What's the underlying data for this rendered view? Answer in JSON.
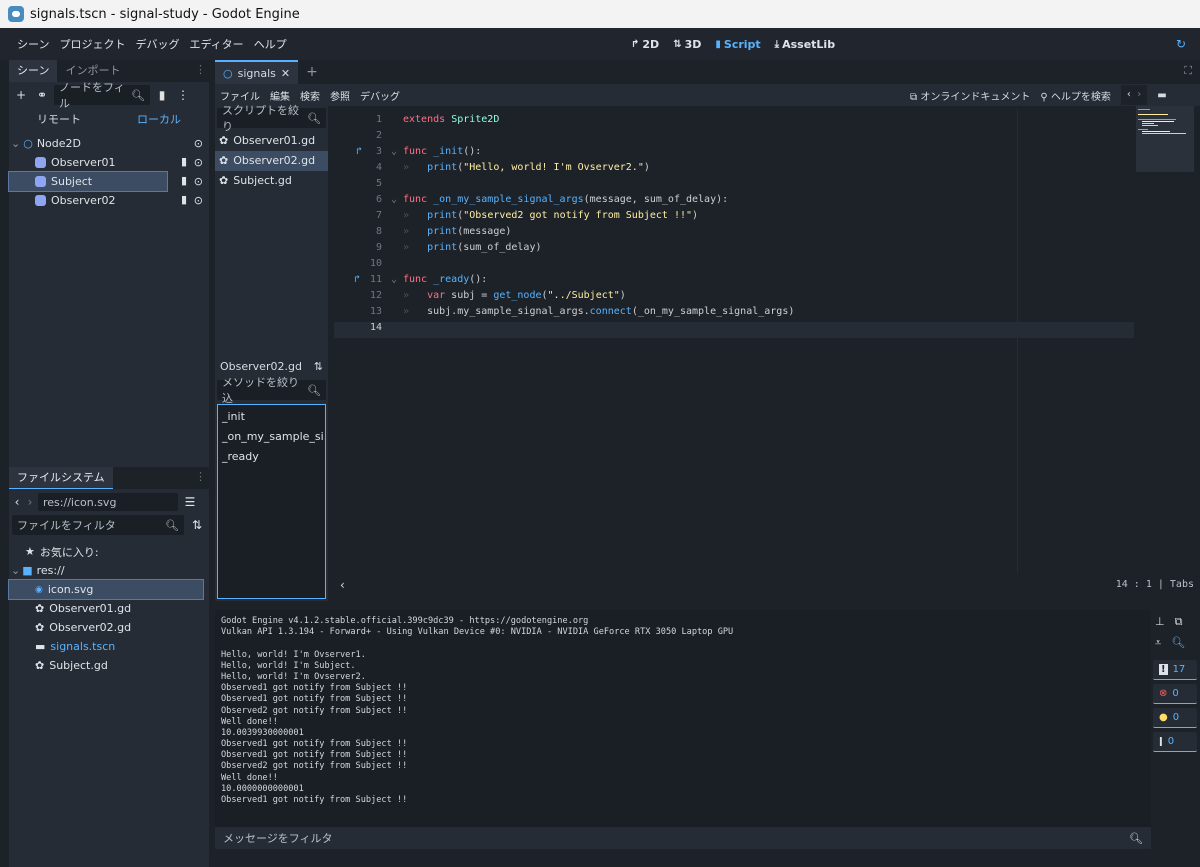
{
  "window_title": "signals.tscn - signal-study - Godot Engine",
  "menubar": {
    "items": [
      "シーン",
      "プロジェクト",
      "デバッグ",
      "エディター",
      "ヘルプ"
    ],
    "workspaces": [
      "2D",
      "3D",
      "Script",
      "AssetLib"
    ]
  },
  "scene_dock": {
    "tabs": [
      "シーン",
      "インポート"
    ],
    "filter_placeholder": "ノードをフィル",
    "remote": "リモート",
    "local": "ローカル",
    "nodes": [
      {
        "name": "Node2D",
        "type": "root"
      },
      {
        "name": "Observer01",
        "type": "child"
      },
      {
        "name": "Subject",
        "type": "child",
        "selected": true
      },
      {
        "name": "Observer02",
        "type": "child"
      }
    ]
  },
  "filesystem_dock": {
    "tab": "ファイルシステム",
    "path": "res://icon.svg",
    "filter_placeholder": "ファイルをフィルタ",
    "favorites": "お気に入り:",
    "root": "res://",
    "files": [
      "icon.svg",
      "Observer01.gd",
      "Observer02.gd",
      "signals.tscn",
      "Subject.gd"
    ]
  },
  "script_editor": {
    "tab": "signals",
    "menu": [
      "ファイル",
      "編集",
      "検索",
      "参照",
      "デバッグ"
    ],
    "online_docs": "オンラインドキュメント",
    "help_search": "ヘルプを検索",
    "script_filter_placeholder": "スクリプトを絞り",
    "scripts": [
      "Observer01.gd",
      "Observer02.gd",
      "Subject.gd"
    ],
    "current_script": "Observer02.gd",
    "method_filter_placeholder": "メソッドを絞り込",
    "methods": [
      "_init",
      "_on_my_sample_si...",
      "_ready"
    ],
    "status": "14 :   1 | Tabs",
    "code_lines": [
      "extends Sprite2D",
      "",
      "func _init():",
      "\tprint(\"Hello, world! I'm Ovserver2.\")",
      "",
      "func _on_my_sample_signal_args(message, sum_of_delay):",
      "\tprint(\"Observed2 got notify from Subject !!\")",
      "\tprint(message)",
      "\tprint(sum_of_delay)",
      "",
      "func _ready():",
      "\tvar subj = get_node(\"../Subject\")",
      "\tsubj.my_sample_signal_args.connect(_on_my_sample_signal_args)",
      ""
    ]
  },
  "output": {
    "lines": [
      "Godot Engine v4.1.2.stable.official.399c9dc39 - https://godotengine.org",
      "Vulkan API 1.3.194 - Forward+ - Using Vulkan Device #0: NVIDIA - NVIDIA GeForce RTX 3050 Laptop GPU",
      "",
      "Hello, world! I'm Ovserver1.",
      "Hello, world! I'm Subject.",
      "Hello, world! I'm Ovserver2.",
      "Observed1 got notify from Subject !!",
      "Observed1 got notify from Subject !!",
      "Observed2 got notify from Subject !!",
      "Well done!!",
      "10.0039930000001",
      "Observed1 got notify from Subject !!",
      "Observed1 got notify from Subject !!",
      "Observed2 got notify from Subject !!",
      "Well done!!",
      "10.0000000000001",
      "Observed1 got notify from Subject !!"
    ],
    "filter_placeholder": "メッセージをフィルタ",
    "counts": {
      "messages": "17",
      "errors": "0",
      "warnings": "0",
      "info": "0"
    }
  },
  "colors": {
    "accent": "#57b3ff",
    "bg": "#1d2229",
    "panel": "#262c35"
  }
}
